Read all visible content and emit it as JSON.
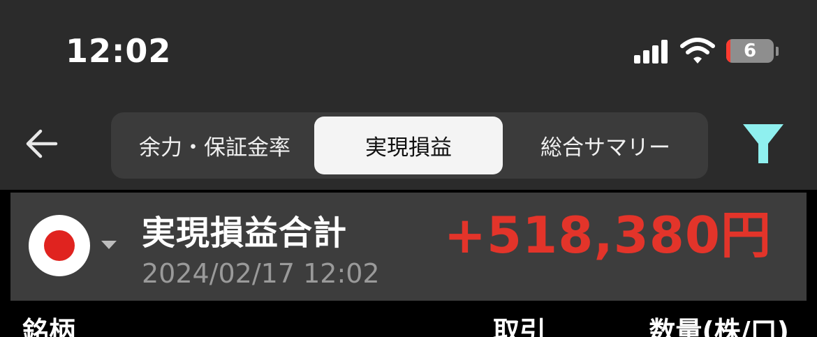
{
  "status_bar": {
    "time": "12:02",
    "battery_level": "6",
    "icons": [
      "cellular-signal-icon",
      "wifi-icon",
      "battery-icon"
    ]
  },
  "nav": {
    "back_icon": "arrow-left-icon",
    "tabs": [
      {
        "label": "余力・保証金率",
        "selected": false
      },
      {
        "label": "実現損益",
        "selected": true
      },
      {
        "label": "総合サマリー",
        "selected": false
      }
    ],
    "filter_icon": "filter-funnel-icon"
  },
  "summary": {
    "market_flag_icon": "japan-flag-icon",
    "title": "実現損益合計",
    "date": "2024/02/17 12:02",
    "amount": "+518,380円"
  },
  "table": {
    "columns": [
      "銘柄",
      "取引",
      "数量(株/口)"
    ]
  },
  "colors": {
    "profit_red": "#e3342a",
    "filter_accent": "#8ff0ef",
    "header_bg": "#2b2b2b",
    "card_bg": "#3d3d3d"
  }
}
